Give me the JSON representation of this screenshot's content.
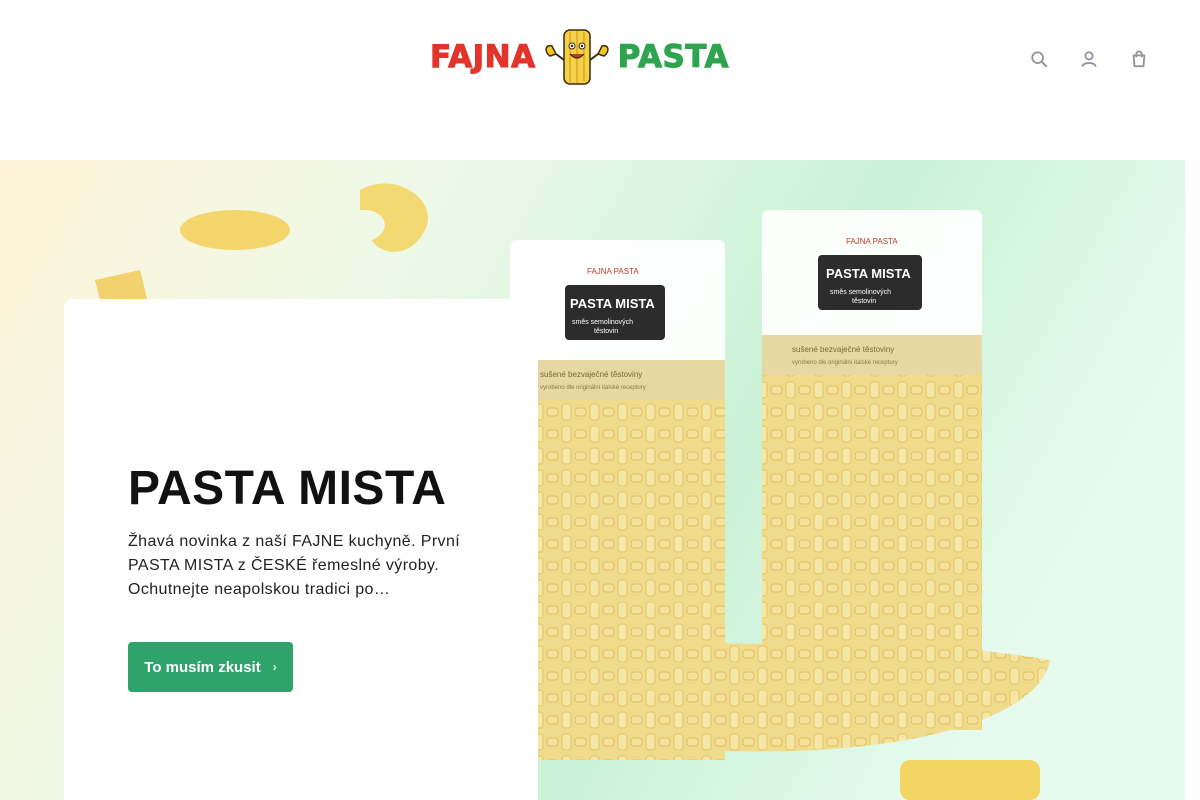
{
  "brand": {
    "name_left": "FAJNA",
    "name_right": "PASTA",
    "mascot_badge": "FAJNA PASTA",
    "color_red": "#e2342b",
    "color_green": "#2ea44f"
  },
  "header_icons": [
    {
      "name": "search-icon"
    },
    {
      "name": "user-icon"
    },
    {
      "name": "cart-icon"
    }
  ],
  "hero": {
    "title": "PASTA MISTA",
    "description": "Žhavá novinka z naší FAJNE kuchyně. První PASTA MISTA z ČESKÉ řemeslné výroby. Ochutnejte neapolskou tradici po…",
    "cta_label": "To musím zkusit",
    "cta_icon": "arrow-right-icon",
    "cta_color": "#2ea36b"
  },
  "packages": [
    {
      "badge": "FAJNA PASTA",
      "title": "PASTA MISTA",
      "subtitle_line1": "směs semolinových",
      "subtitle_line2": "těstovin",
      "caption": "sušené bezvaječné těstoviny",
      "small_caption": "vyrobeno dle originální italské receptury"
    },
    {
      "badge": "FAJNA PASTA",
      "title": "PASTA MISTA",
      "subtitle_line1": "směs semolinových",
      "subtitle_line2": "těstovin",
      "caption": "sušené bezvaječné těstoviny",
      "small_caption": "vyrobeno dle originální italské receptury"
    }
  ]
}
